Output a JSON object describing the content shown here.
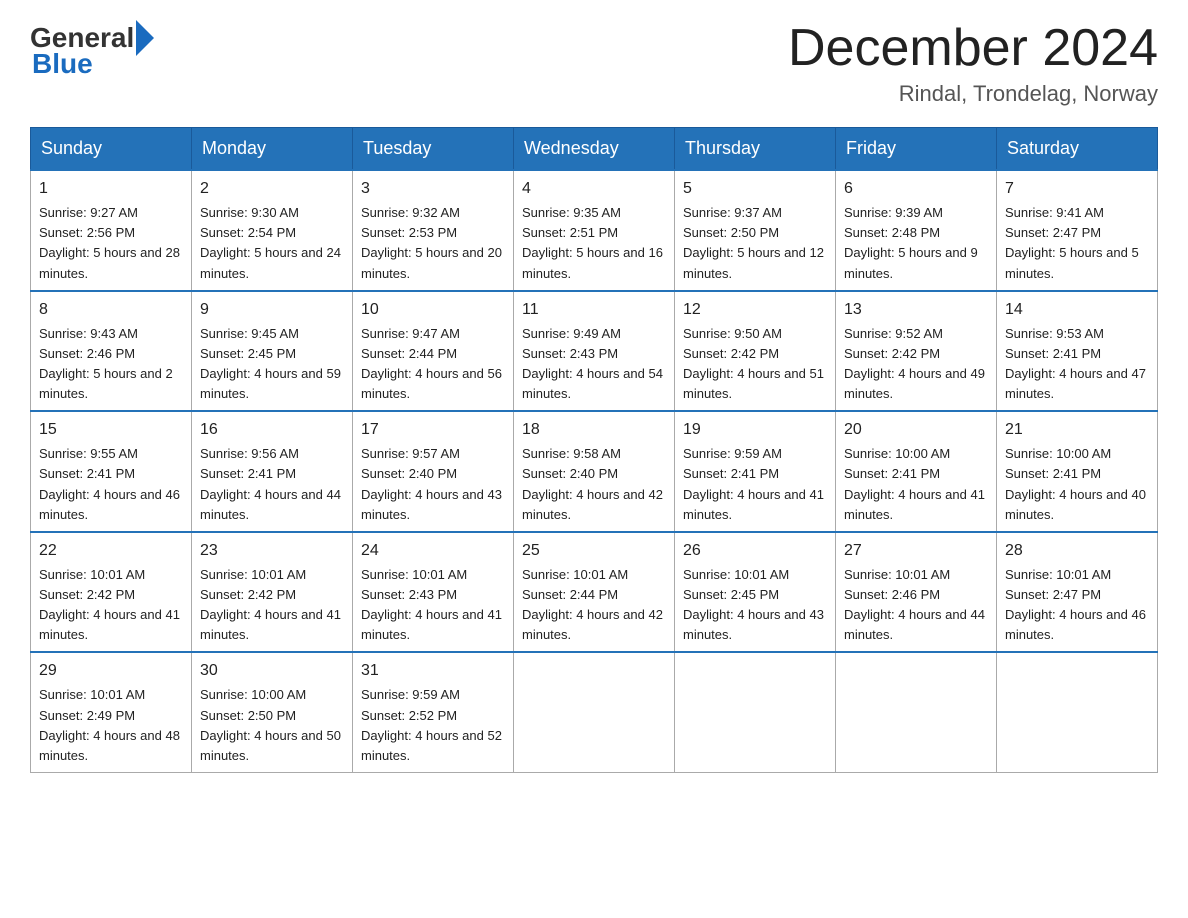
{
  "logo": {
    "general": "General",
    "blue": "Blue"
  },
  "header": {
    "month": "December 2024",
    "location": "Rindal, Trondelag, Norway"
  },
  "days": [
    "Sunday",
    "Monday",
    "Tuesday",
    "Wednesday",
    "Thursday",
    "Friday",
    "Saturday"
  ],
  "weeks": [
    [
      {
        "day": "1",
        "sunrise": "9:27 AM",
        "sunset": "2:56 PM",
        "daylight": "5 hours and 28 minutes."
      },
      {
        "day": "2",
        "sunrise": "9:30 AM",
        "sunset": "2:54 PM",
        "daylight": "5 hours and 24 minutes."
      },
      {
        "day": "3",
        "sunrise": "9:32 AM",
        "sunset": "2:53 PM",
        "daylight": "5 hours and 20 minutes."
      },
      {
        "day": "4",
        "sunrise": "9:35 AM",
        "sunset": "2:51 PM",
        "daylight": "5 hours and 16 minutes."
      },
      {
        "day": "5",
        "sunrise": "9:37 AM",
        "sunset": "2:50 PM",
        "daylight": "5 hours and 12 minutes."
      },
      {
        "day": "6",
        "sunrise": "9:39 AM",
        "sunset": "2:48 PM",
        "daylight": "5 hours and 9 minutes."
      },
      {
        "day": "7",
        "sunrise": "9:41 AM",
        "sunset": "2:47 PM",
        "daylight": "5 hours and 5 minutes."
      }
    ],
    [
      {
        "day": "8",
        "sunrise": "9:43 AM",
        "sunset": "2:46 PM",
        "daylight": "5 hours and 2 minutes."
      },
      {
        "day": "9",
        "sunrise": "9:45 AM",
        "sunset": "2:45 PM",
        "daylight": "4 hours and 59 minutes."
      },
      {
        "day": "10",
        "sunrise": "9:47 AM",
        "sunset": "2:44 PM",
        "daylight": "4 hours and 56 minutes."
      },
      {
        "day": "11",
        "sunrise": "9:49 AM",
        "sunset": "2:43 PM",
        "daylight": "4 hours and 54 minutes."
      },
      {
        "day": "12",
        "sunrise": "9:50 AM",
        "sunset": "2:42 PM",
        "daylight": "4 hours and 51 minutes."
      },
      {
        "day": "13",
        "sunrise": "9:52 AM",
        "sunset": "2:42 PM",
        "daylight": "4 hours and 49 minutes."
      },
      {
        "day": "14",
        "sunrise": "9:53 AM",
        "sunset": "2:41 PM",
        "daylight": "4 hours and 47 minutes."
      }
    ],
    [
      {
        "day": "15",
        "sunrise": "9:55 AM",
        "sunset": "2:41 PM",
        "daylight": "4 hours and 46 minutes."
      },
      {
        "day": "16",
        "sunrise": "9:56 AM",
        "sunset": "2:41 PM",
        "daylight": "4 hours and 44 minutes."
      },
      {
        "day": "17",
        "sunrise": "9:57 AM",
        "sunset": "2:40 PM",
        "daylight": "4 hours and 43 minutes."
      },
      {
        "day": "18",
        "sunrise": "9:58 AM",
        "sunset": "2:40 PM",
        "daylight": "4 hours and 42 minutes."
      },
      {
        "day": "19",
        "sunrise": "9:59 AM",
        "sunset": "2:41 PM",
        "daylight": "4 hours and 41 minutes."
      },
      {
        "day": "20",
        "sunrise": "10:00 AM",
        "sunset": "2:41 PM",
        "daylight": "4 hours and 41 minutes."
      },
      {
        "day": "21",
        "sunrise": "10:00 AM",
        "sunset": "2:41 PM",
        "daylight": "4 hours and 40 minutes."
      }
    ],
    [
      {
        "day": "22",
        "sunrise": "10:01 AM",
        "sunset": "2:42 PM",
        "daylight": "4 hours and 41 minutes."
      },
      {
        "day": "23",
        "sunrise": "10:01 AM",
        "sunset": "2:42 PM",
        "daylight": "4 hours and 41 minutes."
      },
      {
        "day": "24",
        "sunrise": "10:01 AM",
        "sunset": "2:43 PM",
        "daylight": "4 hours and 41 minutes."
      },
      {
        "day": "25",
        "sunrise": "10:01 AM",
        "sunset": "2:44 PM",
        "daylight": "4 hours and 42 minutes."
      },
      {
        "day": "26",
        "sunrise": "10:01 AM",
        "sunset": "2:45 PM",
        "daylight": "4 hours and 43 minutes."
      },
      {
        "day": "27",
        "sunrise": "10:01 AM",
        "sunset": "2:46 PM",
        "daylight": "4 hours and 44 minutes."
      },
      {
        "day": "28",
        "sunrise": "10:01 AM",
        "sunset": "2:47 PM",
        "daylight": "4 hours and 46 minutes."
      }
    ],
    [
      {
        "day": "29",
        "sunrise": "10:01 AM",
        "sunset": "2:49 PM",
        "daylight": "4 hours and 48 minutes."
      },
      {
        "day": "30",
        "sunrise": "10:00 AM",
        "sunset": "2:50 PM",
        "daylight": "4 hours and 50 minutes."
      },
      {
        "day": "31",
        "sunrise": "9:59 AM",
        "sunset": "2:52 PM",
        "daylight": "4 hours and 52 minutes."
      },
      null,
      null,
      null,
      null
    ]
  ]
}
